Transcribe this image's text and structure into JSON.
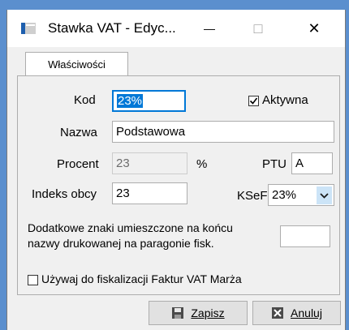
{
  "window": {
    "title": "Stawka VAT - Edyc...",
    "minimize_glyph": "—",
    "maximize_glyph": "□",
    "close_glyph": "✕"
  },
  "tabs": [
    {
      "label": "Właściwości"
    }
  ],
  "form": {
    "kod_label": "Kod",
    "kod_value": "23%",
    "aktywna_label": "Aktywna",
    "aktywna_checked": true,
    "nazwa_label": "Nazwa",
    "nazwa_value": "Podstawowa",
    "procent_label": "Procent",
    "procent_value": "23",
    "procent_unit": "%",
    "ptu_label": "PTU",
    "ptu_value": "A",
    "indeks_label": "Indeks obcy",
    "indeks_value": "23",
    "ksef_label": "KSeF",
    "ksef_value": "23%",
    "dodatkowe_label_line1": "Dodatkowe znaki umieszczone na końcu",
    "dodatkowe_label_line2": "nazwy drukowanej na paragonie fisk.",
    "dodatkowe_value": "",
    "marza_label": "Używaj do fiskalizacji Faktur VAT Marża",
    "marza_checked": false
  },
  "buttons": {
    "save_label": "Zapisz",
    "cancel_label": "Anuluj"
  },
  "colors": {
    "accent": "#0078d7",
    "frame": "#5b8fce",
    "dialog_bg": "#f0f0f0"
  }
}
